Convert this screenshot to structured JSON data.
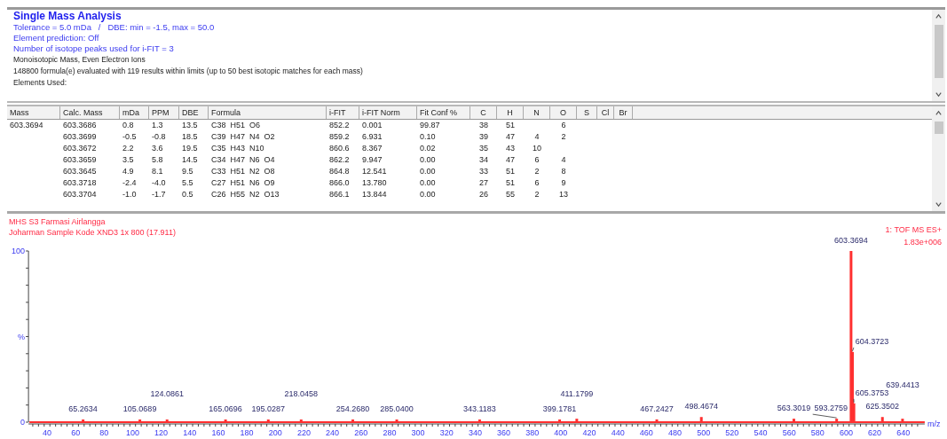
{
  "summary": {
    "title": "Single Mass Analysis",
    "lines": [
      {
        "text": "Tolerance = 5.0 mDa   /   DBE: min = -1.5, max = 50.0",
        "kind": "setting"
      },
      {
        "text": "Element prediction: Off",
        "kind": "setting"
      },
      {
        "text": "Number of isotope peaks used for i-FIT = 3",
        "kind": "setting"
      },
      {
        "text": "Monoisotopic Mass, Even Electron Ions",
        "kind": "info"
      },
      {
        "text": "148800 formula(e) evaluated with 119 results within limits (up to 50 best isotopic matches for each mass)",
        "kind": "info"
      },
      {
        "text": "Elements Used:",
        "kind": "info"
      }
    ]
  },
  "table": {
    "columns": [
      "Mass",
      "Calc. Mass",
      "mDa",
      "PPM",
      "DBE",
      "Formula",
      "i-FIT",
      "i-FIT Norm",
      "Fit Conf %",
      "C",
      "H",
      "N",
      "O",
      "S",
      "Cl",
      "Br"
    ],
    "rows": [
      [
        "603.3694",
        "603.3686",
        "0.8",
        "1.3",
        "13.5",
        "C38  H51  O6",
        "852.2",
        "0.001",
        "99.87",
        "38",
        "51",
        null,
        "6",
        null,
        null,
        null
      ],
      [
        null,
        "603.3699",
        "-0.5",
        "-0.8",
        "18.5",
        "C39  H47  N4  O2",
        "859.2",
        "6.931",
        "0.10",
        "39",
        "47",
        "4",
        "2",
        null,
        null,
        null
      ],
      [
        null,
        "603.3672",
        "2.2",
        "3.6",
        "19.5",
        "C35  H43  N10",
        "860.6",
        "8.367",
        "0.02",
        "35",
        "43",
        "10",
        null,
        null,
        null,
        null
      ],
      [
        null,
        "603.3659",
        "3.5",
        "5.8",
        "14.5",
        "C34  H47  N6  O4",
        "862.2",
        "9.947",
        "0.00",
        "34",
        "47",
        "6",
        "4",
        null,
        null,
        null
      ],
      [
        null,
        "603.3645",
        "4.9",
        "8.1",
        "9.5",
        "C33  H51  N2  O8",
        "864.8",
        "12.541",
        "0.00",
        "33",
        "51",
        "2",
        "8",
        null,
        null,
        null
      ],
      [
        null,
        "603.3718",
        "-2.4",
        "-4.0",
        "5.5",
        "C27  H51  N6  O9",
        "866.0",
        "13.780",
        "0.00",
        "27",
        "51",
        "6",
        "9",
        null,
        null,
        null
      ],
      [
        null,
        "603.3704",
        "-1.0",
        "-1.7",
        "0.5",
        "C26  H55  N2  O13",
        "866.1",
        "13.844",
        "0.00",
        "26",
        "55",
        "2",
        "13",
        null,
        null,
        null
      ]
    ]
  },
  "spectrum": {
    "header_lines": [
      "MHS S3 Farmasi Airlangga",
      "Joharman Sample Kode XND3  1x 800 (17.911)"
    ],
    "function_label": "1: TOF MS ES+",
    "intensity": "1.83e+006",
    "chart_data": {
      "type": "bar",
      "xlabel": "m/z",
      "ylabel": "%",
      "annotations": [
        "65.2634",
        "105.0689",
        "124.0861",
        "165.0696",
        "195.0287",
        "218.0458",
        "254.2680",
        "285.0400",
        "343.1183",
        "399.1781",
        "411.1799",
        "467.2427",
        "498.4674",
        "563.3019",
        "593.2759",
        "603.3694",
        "604.3723",
        "605.3753",
        "625.3502",
        "639.4413"
      ],
      "x": [
        65.2634,
        105.0689,
        124.0861,
        165.0696,
        195.0287,
        218.0458,
        254.268,
        285.04,
        343.1183,
        399.1781,
        411.1799,
        467.2427,
        498.4674,
        563.3019,
        593.2759,
        603.3694,
        604.3723,
        605.3753,
        625.3502,
        639.4413
      ],
      "values": [
        1.5,
        1.5,
        1.5,
        1.5,
        1.5,
        1.5,
        1.5,
        1.5,
        1.5,
        1.5,
        2,
        1.6,
        3,
        2,
        2,
        100,
        41,
        11,
        3,
        2
      ],
      "xlim": [
        27,
        655
      ],
      "ylim": [
        0,
        100
      ],
      "xticks": [
        40,
        60,
        80,
        100,
        120,
        140,
        160,
        180,
        200,
        220,
        240,
        260,
        280,
        300,
        320,
        340,
        360,
        380,
        400,
        420,
        440,
        460,
        480,
        500,
        520,
        540,
        560,
        580,
        600,
        620,
        640
      ],
      "yticks": [
        0,
        100
      ]
    }
  }
}
